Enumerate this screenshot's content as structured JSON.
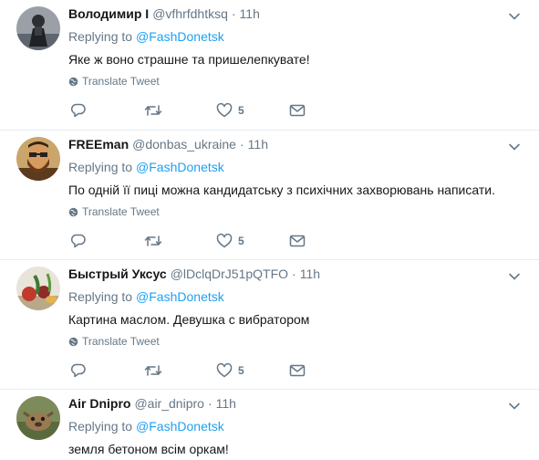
{
  "tweets": [
    {
      "name": "Володимир I",
      "handle": "@vfhrfdhtksq",
      "separator": "·",
      "time": "11h",
      "replying_label": "Replying to",
      "replying_to": "@FashDonetsk",
      "text": "Яке ж воно страшне та пришелепкувате!",
      "translate_label": "Translate Tweet",
      "likes": "5",
      "avatar_icon": "dark-figure-avatar"
    },
    {
      "name": "FREEman",
      "handle": "@donbas_ukraine",
      "separator": "·",
      "time": "11h",
      "replying_label": "Replying to",
      "replying_to": "@FashDonetsk",
      "text": "По одній її пиці можна кандидатську з психічних захворювань написати.",
      "translate_label": "Translate Tweet",
      "likes": "5",
      "avatar_icon": "bearded-man-avatar"
    },
    {
      "name": "Быстрый Уксус",
      "handle": "@lDclqDrJ51pQTFO",
      "separator": "·",
      "time": "11h",
      "replying_label": "Replying to",
      "replying_to": "@FashDonetsk",
      "text": "Картина маслом. Девушка с вибратором",
      "translate_label": "Translate Tweet",
      "likes": "5",
      "avatar_icon": "vegetables-avatar"
    },
    {
      "name": "Air Dnipro",
      "handle": "@air_dnipro",
      "separator": "·",
      "time": "11h",
      "replying_label": "Replying to",
      "replying_to": "@FashDonetsk",
      "text": "земля бетоном всім оркам!",
      "avatar_icon": "animal-avatar"
    }
  ],
  "colors": {
    "link": "#1da1f2",
    "secondary_text": "#657786",
    "primary_text": "#14171a",
    "divider": "#e6ecf0"
  }
}
